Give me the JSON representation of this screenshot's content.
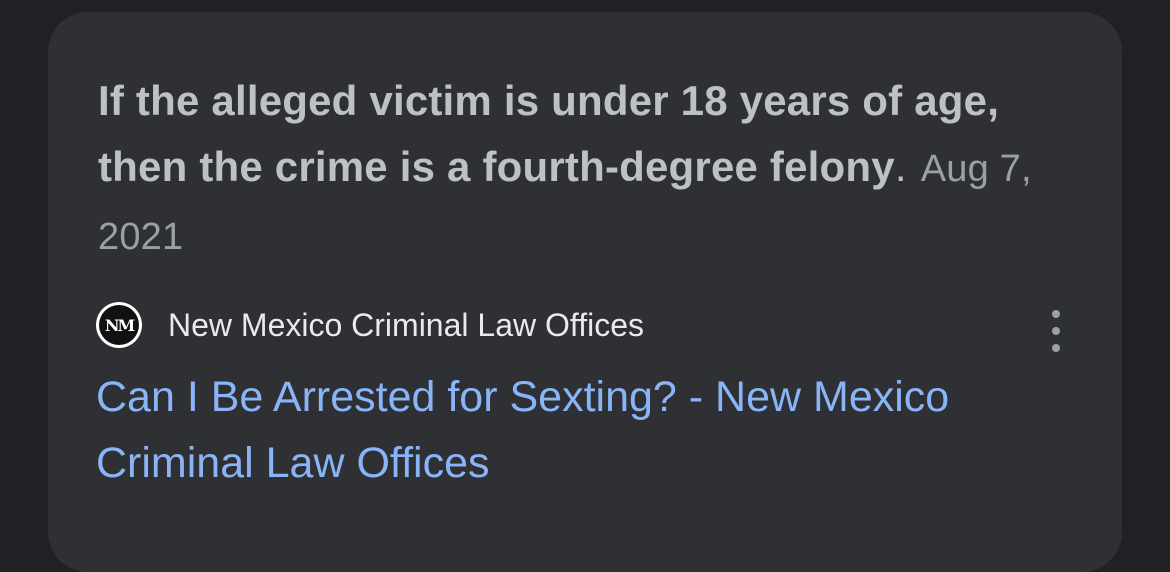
{
  "snippet": {
    "text": "If the alleged victim is under 18 years of age, then the crime is a fourth-degree felony",
    "punctuation": ".",
    "date": "Aug 7, 2021"
  },
  "source": {
    "favicon_text": "NM",
    "name": "New Mexico Criminal Law Offices",
    "more_icon": "more-vert-icon"
  },
  "result": {
    "title": "Can I Be Arrested for Sexting? - New Mexico Criminal Law Offices"
  },
  "colors": {
    "background": "#202124",
    "card": "#2f3033",
    "snippet_text": "#bdc1c6",
    "link": "#8ab4f8"
  }
}
